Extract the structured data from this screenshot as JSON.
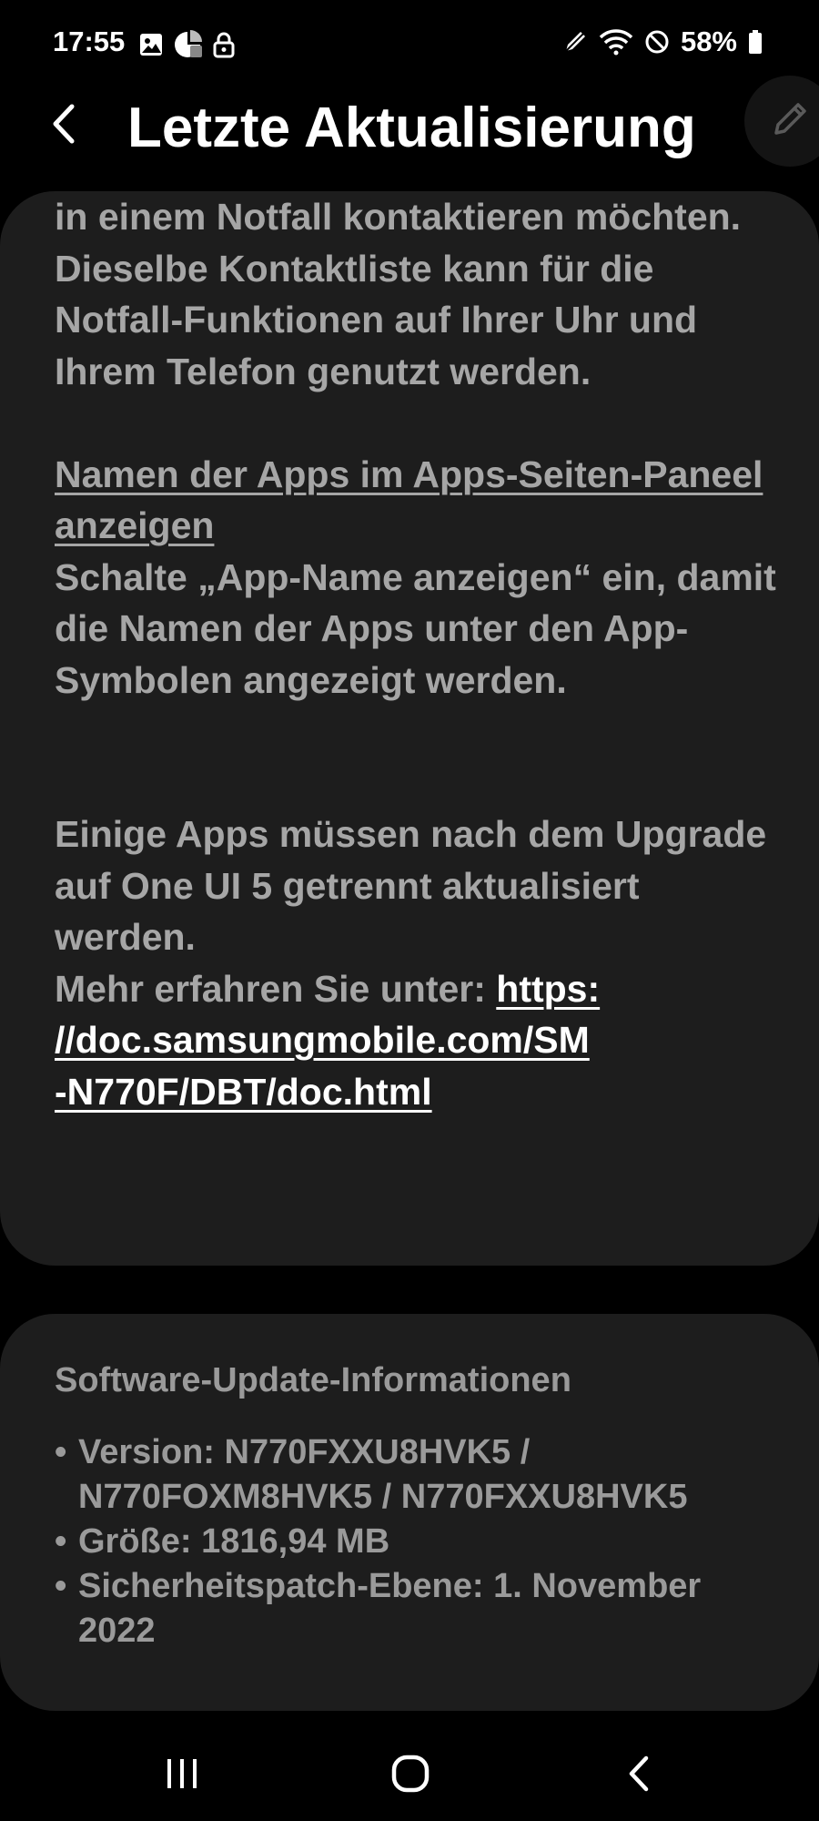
{
  "status_bar": {
    "time": "17:55",
    "left_icons": [
      "image-icon",
      "pie-chart-icon",
      "lock-icon"
    ],
    "right_icons": [
      "pen-icon",
      "wifi-icon",
      "do-not-disturb-icon",
      "battery-icon"
    ],
    "battery_percent": "58%"
  },
  "header": {
    "title": "Letzte Aktualisierung",
    "back_icon": "back-arrow-icon",
    "edit_icon": "pencil-icon"
  },
  "notes": {
    "paragraph_1": "in einem Notfall kontaktieren möchten. Dieselbe Kontaktliste kann für die Notfall-Funktionen auf Ihrer Uhr und Ihrem Telefon genutzt werden.",
    "feature_title": "Namen der Apps im Apps-Seiten-Paneel anzeigen",
    "feature_text": "Schalte „App-Name anzeigen“ ein, damit die Namen der Apps unter den App-Symbolen angezeigt werden.",
    "upgrade_text": "Einige Apps müssen nach dem Upgrade auf One UI 5 getrennt aktualisiert werden.",
    "more_info_prefix": "Mehr erfahren Sie unter: ",
    "more_info_link": "https://doc.samsungmobile.com/SM-N770F/DBT/doc.html",
    "more_info_link_lines": [
      "https:",
      "//doc.samsungmobile.com/SM",
      "-N770F/DBT/doc.html"
    ]
  },
  "software_info": {
    "title": "Software-Update-Informationen",
    "items": [
      "Version: N770FXXU8HVK5 / N770FOXM8HVK5 / N770FXXU8HVK5",
      "Größe: 1816,94 MB",
      "Sicherheitspatch-Ebene: 1. November 2022"
    ]
  },
  "nav_bar": {
    "recents_icon": "recents-icon",
    "home_icon": "home-icon",
    "back_icon": "nav-back-icon"
  },
  "colors": {
    "background": "#000000",
    "card": "#1d1d1d",
    "body_text": "#a6a6a6",
    "secondary_text": "#9a9a9a",
    "link": "#ffffff"
  }
}
